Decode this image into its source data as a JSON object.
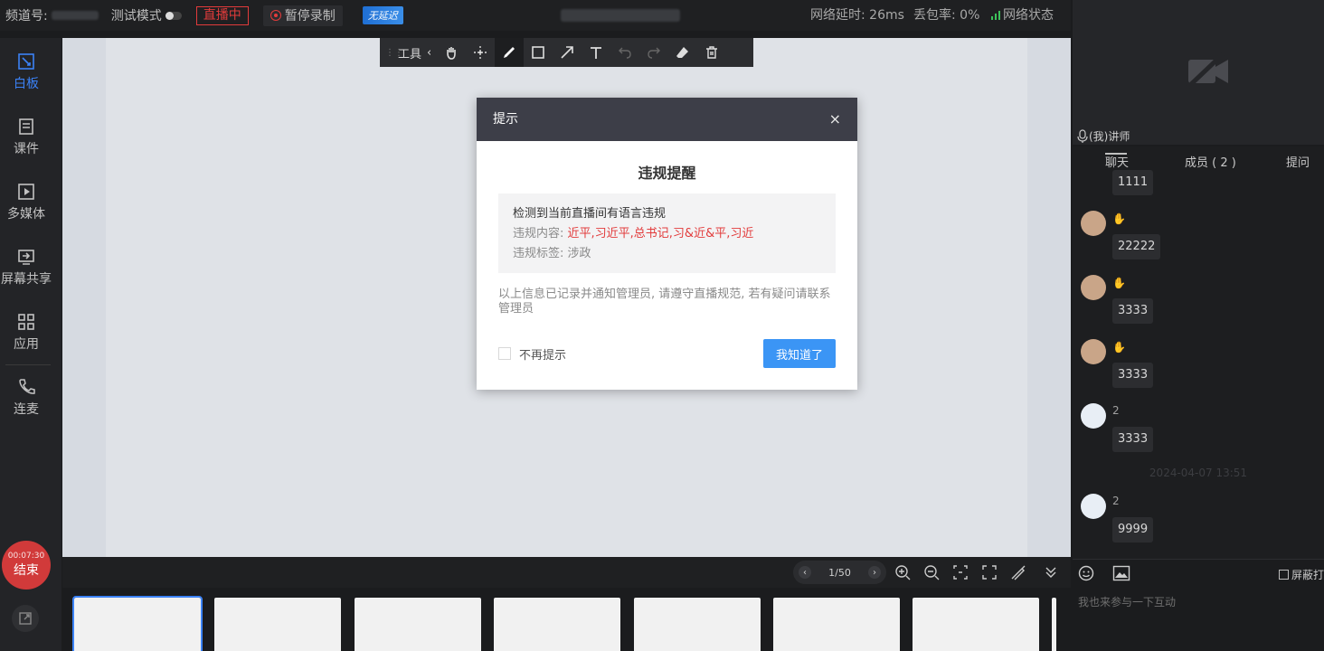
{
  "topbar": {
    "channel_label": "频道号:",
    "test_mode_label": "测试模式",
    "live_label": "直播中",
    "record_label": "暂停录制",
    "badge_label": "无延迟",
    "latency": "网络延时: 26ms",
    "packet_loss": "丢包率: 0%",
    "net_status": "网络状态"
  },
  "sidebar": {
    "items": [
      {
        "label": "白板",
        "icon": "whiteboard-icon"
      },
      {
        "label": "课件",
        "icon": "courseware-icon"
      },
      {
        "label": "多媒体",
        "icon": "media-icon"
      },
      {
        "label": "屏幕共享",
        "icon": "screen-share-icon"
      },
      {
        "label": "应用",
        "icon": "apps-icon"
      },
      {
        "label": "连麦",
        "icon": "phone-icon"
      }
    ],
    "end_time": "00:07:30",
    "end_label": "结束"
  },
  "toolbar": {
    "label": "工具",
    "tools": [
      "hand-icon",
      "move-icon",
      "pen-icon",
      "rectangle-icon",
      "arrow-icon",
      "text-icon",
      "undo-icon",
      "redo-icon",
      "eraser-icon",
      "delete-icon"
    ]
  },
  "bottom": {
    "page": "1/50"
  },
  "right": {
    "speaker": "(我)讲师",
    "tabs": [
      "聊天",
      "成员 ( 2 )",
      "提问"
    ],
    "messages": [
      {
        "text": "1111"
      },
      {
        "user": "",
        "text": "22222"
      },
      {
        "user": "",
        "text": "3333"
      },
      {
        "user": "",
        "text": "3333"
      },
      {
        "user": "2",
        "text": "3333"
      },
      {
        "timestamp": "2024-04-07 13:51"
      },
      {
        "user": "2",
        "text": "9999"
      }
    ],
    "mask_label": "屏蔽打",
    "input_placeholder": "我也来参与一下互动"
  },
  "modal": {
    "header": "提示",
    "close": "×",
    "title": "违规提醒",
    "detected": "检测到当前直播间有语言违规",
    "content_key": "违规内容:",
    "content_value": "近平,习近平,总书记,习&近&平,习近",
    "tag_key": "违规标签:",
    "tag_value": "涉政",
    "note": "以上信息已记录并通知管理员, 请遵守直播规范, 若有疑问请联系管理员",
    "checkbox_label": "不再提示",
    "ok_label": "我知道了"
  },
  "colors": {
    "accent": "#3b82f6",
    "danger": "#e23b3b",
    "primary_button": "#3b95f5"
  }
}
